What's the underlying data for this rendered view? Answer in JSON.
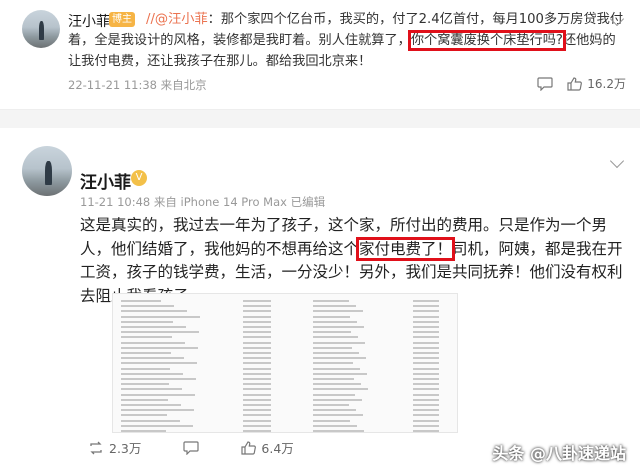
{
  "post1": {
    "username": "汪小菲",
    "badge": "博主",
    "text_segments": [
      {
        "text": "//@汪小菲",
        "style": "mention"
      },
      {
        "text": "：那个家四个亿台币，我买的，付了2.4亿首付，每月100多万房贷我付着，全是我设计的风格，装修都是我盯着。别人住就算了，",
        "style": "normal"
      },
      {
        "text": "你个窝囊废换个床垫行吗?",
        "style": "highlight"
      },
      {
        "text": "还他妈的让我付电费，还让我孩子在那儿。都给我回北京来！",
        "style": "normal"
      }
    ],
    "meta": "22-11-21 11:38 来自北京",
    "likes": "16.2万"
  },
  "post2": {
    "username": "汪小菲",
    "verified_badge": "V",
    "meta": "11-21 10:48 来自 iPhone 14 Pro Max 已编辑",
    "text_segments": [
      {
        "text": "这是真实的，我过去一年为了孩子，这个家，所付出的费用。只是作为一个男人，他们结婚了，我他妈的不想再给这个",
        "style": "normal"
      },
      {
        "text": "家付电费了！",
        "style": "highlight"
      },
      {
        "text": "司机，阿姨，都是我在开工资，孩子的钱学费，生活，一分没少！另外，我们是共同抚养！他们没有权利去阻止我看孩子",
        "style": "normal"
      }
    ],
    "reposts": "2.3万",
    "likes": "6.4万"
  },
  "watermark": "头条 @八卦速递站",
  "colors": {
    "highlight_border": "#e0101a",
    "mention": "#eb7350",
    "badge": "#f6b445"
  }
}
